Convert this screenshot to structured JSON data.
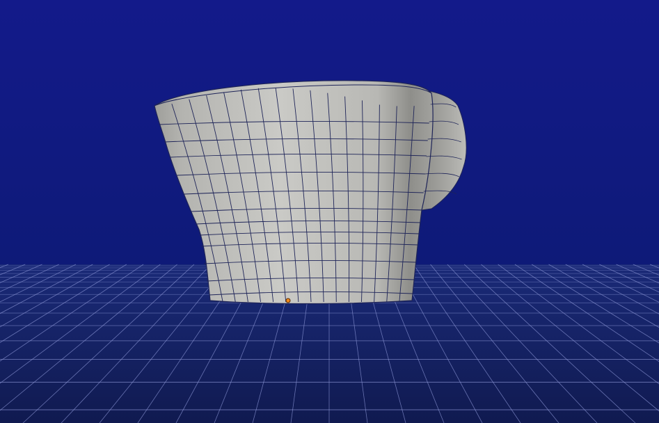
{
  "viewport": {
    "background_top": "#131a8a",
    "background_horizon": "#0f1d7a",
    "floor_color": "#13205f",
    "grid_color": "#8c96d6",
    "mesh_color": "#c8c8c4",
    "mesh_wire_color": "#1e2458",
    "origin_marker_color": "#f08a1e"
  },
  "scene": {
    "object": "mesh-object",
    "selected_origin_visible": true
  }
}
